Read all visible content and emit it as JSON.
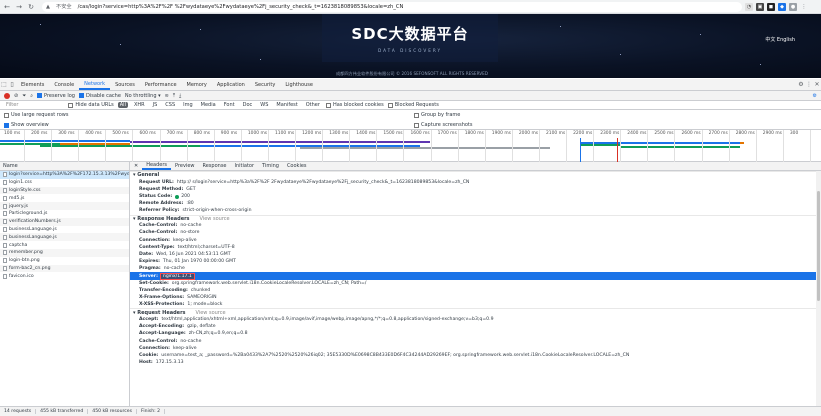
{
  "browser": {
    "security_label": "不安全",
    "url": "/cas/login?service=http%3A%2F%2F                  %2Fwydataeye%2Fwydataeye%2Fj_security_check&_t=1623818089853&locale=zh_CN"
  },
  "site": {
    "title": "SDC大数据平台",
    "subtitle": "DATA DISCOVERY",
    "copyright": "成都四方伟业软件股份有限公司 © 2016 SEFONSOFT ALL RIGHTS RESERVED",
    "lang": "中文 English"
  },
  "devtools": {
    "tabs": [
      "Elements",
      "Console",
      "Network",
      "Sources",
      "Performance",
      "Memory",
      "Application",
      "Security",
      "Lighthouse"
    ],
    "active_tab": "Network"
  },
  "toolbar": {
    "preserve_log": "Preserve log",
    "disable_cache": "Disable cache",
    "throttling": "No throttling"
  },
  "filter": {
    "label": "Filter",
    "hide_data_urls": "Hide data URLs",
    "types": [
      "All",
      "XHR",
      "JS",
      "CSS",
      "Img",
      "Media",
      "Font",
      "Doc",
      "WS",
      "Manifest",
      "Other"
    ],
    "blocked_cookies": "Has blocked cookies",
    "blocked_requests": "Blocked Requests"
  },
  "options": {
    "large_rows": "Use large request rows",
    "show_overview": "Show overview",
    "group_by_frame": "Group by frame",
    "capture_screenshots": "Capture screenshots"
  },
  "timeline": {
    "ticks": [
      "100 ms",
      "200 ms",
      "300 ms",
      "400 ms",
      "500 ms",
      "600 ms",
      "700 ms",
      "800 ms",
      "900 ms",
      "1000 ms",
      "1100 ms",
      "1200 ms",
      "1300 ms",
      "1400 ms",
      "1500 ms",
      "1600 ms",
      "1700 ms",
      "1800 ms",
      "1900 ms",
      "2000 ms",
      "2100 ms",
      "2200 ms",
      "2300 ms",
      "2400 ms",
      "2500 ms",
      "2600 ms",
      "2700 ms",
      "2800 ms",
      "2900 ms",
      "300"
    ]
  },
  "requests": {
    "header": "Name",
    "items": [
      "login?service=http%3A%2F%2F172.15.3.13%2Fwydataeye...",
      "login1.css",
      "loginStyle.css",
      "md5.js",
      "jquery.js",
      "Particleground.js",
      "verificationNumbers.js",
      "businessLanguage.js",
      "businessLanguage.js",
      "captcha",
      "remember.png",
      "login-btn.png",
      "form-bac2_cn.png",
      "favicon.ico"
    ]
  },
  "detail": {
    "tabs": [
      "Headers",
      "Preview",
      "Response",
      "Initiator",
      "Timing",
      "Cookies"
    ],
    "general_title": "General",
    "general": [
      {
        "k": "Request URL:",
        "v": "http://                 s/login?service=http%3a%2F%2F              2Fwydataeye%2Fwydataeye%2Fj_security_check&_t=1623818089853&locale=zh_CN"
      },
      {
        "k": "Request Method:",
        "v": "GET"
      },
      {
        "k": "Status Code:",
        "v": "200"
      },
      {
        "k": "Remote Address:",
        "v": "              :80"
      },
      {
        "k": "Referrer Policy:",
        "v": "strict-origin-when-cross-origin"
      }
    ],
    "response_title": "Response Headers",
    "view_source": "View source",
    "response": [
      {
        "k": "Cache-Control:",
        "v": "no-cache"
      },
      {
        "k": "Cache-Control:",
        "v": "no-store"
      },
      {
        "k": "Connection:",
        "v": "keep-alive"
      },
      {
        "k": "Content-Type:",
        "v": "text/html;charset=UTF-8"
      },
      {
        "k": "Date:",
        "v": "Wed, 16 Jun 2021 04:53:11 GMT"
      },
      {
        "k": "Expires:",
        "v": "Thu, 01 Jan 1970 00:00:00 GMT"
      },
      {
        "k": "Pragma:",
        "v": "no-cache"
      },
      {
        "k": "Server:",
        "v": "nginx/1.17.1"
      },
      {
        "k": "Set-Cookie:",
        "v": "org.springframework.web.servlet.i18n.CookieLocaleResolver.LOCALE=zh_CN; Path=/"
      },
      {
        "k": "Transfer-Encoding:",
        "v": "chunked"
      },
      {
        "k": "X-Frame-Options:",
        "v": "SAMEORIGIN"
      },
      {
        "k": "X-XSS-Protection:",
        "v": "1; mode=block"
      }
    ],
    "request_title": "Request Headers",
    "request": [
      {
        "k": "Accept:",
        "v": "text/html,application/xhtml+xml,application/xml;q=0.9,image/avif,image/webp,image/apng,*/*;q=0.8,application/signed-exchange;v=b3;q=0.9"
      },
      {
        "k": "Accept-Encoding:",
        "v": "gzip, deflate"
      },
      {
        "k": "Accept-Language:",
        "v": "zh-CN,zh;q=0.9,en;q=0.8"
      },
      {
        "k": "Cache-Control:",
        "v": "no-cache"
      },
      {
        "k": "Connection:",
        "v": "keep-alive"
      },
      {
        "k": "Cookie:",
        "v": "username=test_a; _password=%2Ba0433%2A7%2520%2520%26iq02; 35E5330D%E0698C8B433E0D6F4C34244AD29269EF; org.springframework.web.servlet.i18n.CookieLocaleResolver.LOCALE=zh_CN"
      },
      {
        "k": "Host:",
        "v": "172.15.3.13"
      }
    ]
  },
  "status": {
    "requests": "14 requests",
    "transferred": "455 kB transferred",
    "resources": "450 kB resources",
    "finish": "Finish: 2"
  }
}
